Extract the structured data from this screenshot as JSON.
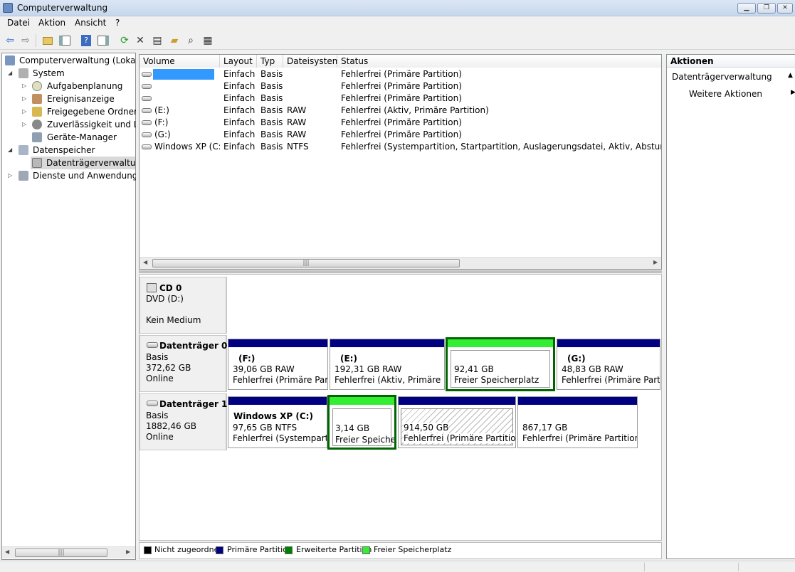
{
  "window": {
    "title": "Computerverwaltung"
  },
  "menubar": {
    "items": [
      "Datei",
      "Aktion",
      "Ansicht",
      "?"
    ]
  },
  "toolbar": {
    "icons": [
      "back-icon",
      "forward-icon",
      "up-folder-icon",
      "show-hide-tree-icon",
      "help-icon",
      "show-hide-action-pane-icon",
      "refresh-icon",
      "delete-icon",
      "properties-icon",
      "open-icon",
      "search-icon",
      "disk-settings-icon"
    ]
  },
  "tree": {
    "root": "Computerverwaltung (Lokal)",
    "system": "System",
    "aufgaben": "Aufgabenplanung",
    "ereignis": "Ereignisanzeige",
    "freigabe": "Freigegebene Ordner",
    "zuverl": "Zuverlässigkeit und Leis",
    "geraete": "Geräte-Manager",
    "datenspeicher": "Datenspeicher",
    "datentraeger": "Datenträgerverwaltung",
    "dienste": "Dienste und Anwendungen"
  },
  "volume_table": {
    "headers": {
      "volume": "Volume",
      "layout": "Layout",
      "typ": "Typ",
      "fs": "Dateisystem",
      "status": "Status"
    },
    "rows": [
      {
        "volume": "",
        "layout": "Einfach",
        "typ": "Basis",
        "fs": "",
        "status": "Fehlerfrei (Primäre Partition)"
      },
      {
        "volume": "",
        "layout": "Einfach",
        "typ": "Basis",
        "fs": "",
        "status": "Fehlerfrei (Primäre Partition)"
      },
      {
        "volume": "",
        "layout": "Einfach",
        "typ": "Basis",
        "fs": "",
        "status": "Fehlerfrei (Primäre Partition)"
      },
      {
        "volume": "(E:)",
        "layout": "Einfach",
        "typ": "Basis",
        "fs": "RAW",
        "status": "Fehlerfrei (Aktiv, Primäre Partition)"
      },
      {
        "volume": "(F:)",
        "layout": "Einfach",
        "typ": "Basis",
        "fs": "RAW",
        "status": "Fehlerfrei (Primäre Partition)"
      },
      {
        "volume": "(G:)",
        "layout": "Einfach",
        "typ": "Basis",
        "fs": "RAW",
        "status": "Fehlerfrei (Primäre Partition)"
      },
      {
        "volume": "Windows XP (C:)",
        "layout": "Einfach",
        "typ": "Basis",
        "fs": "NTFS",
        "status": "Fehlerfrei (Systempartition, Startpartition, Auslagerungsdatei, Aktiv, Absturzabbild, Pri"
      }
    ]
  },
  "disks": {
    "cd0": {
      "name": "CD 0",
      "type": "DVD (D:)",
      "status": "Kein Medium"
    },
    "disk0": {
      "name": "Datenträger 0",
      "kind": "Basis",
      "size": "372,62 GB",
      "status": "Online",
      "parts": [
        {
          "label": "(F:)",
          "size": "39,06 GB RAW",
          "status": "Fehlerfrei (Primäre Partit"
        },
        {
          "label": "(E:)",
          "size": "192,31 GB RAW",
          "status": "Fehlerfrei (Aktiv, Primäre Pa"
        },
        {
          "label": "",
          "size": "92,41 GB",
          "status": "Freier Speicherplatz"
        },
        {
          "label": "(G:)",
          "size": "48,83 GB RAW",
          "status": "Fehlerfrei (Primäre Partiti"
        }
      ]
    },
    "disk1": {
      "name": "Datenträger 1",
      "kind": "Basis",
      "size": "1882,46 GB",
      "status": "Online",
      "parts": [
        {
          "label": "Windows XP  (C:)",
          "size": "97,65 GB NTFS",
          "status": "Fehlerfrei (Systempartiti"
        },
        {
          "label": "",
          "size": "3,14 GB",
          "status": "Freier Speiche"
        },
        {
          "label": "",
          "size": "914,50 GB",
          "status": "Fehlerfrei (Primäre Partition)"
        },
        {
          "label": "",
          "size": "867,17 GB",
          "status": "Fehlerfrei (Primäre Partition)"
        }
      ]
    }
  },
  "legend": [
    {
      "label": "Nicht zugeordnet",
      "color": "#000000"
    },
    {
      "label": "Primäre Partition",
      "color": "#000080"
    },
    {
      "label": "Erweiterte Partition",
      "color": "#008000"
    },
    {
      "label": "Freier Speicherplatz",
      "color": "#33ee33"
    }
  ],
  "actions": {
    "title": "Aktionen",
    "section": "Datenträgerverwaltung",
    "more": "Weitere Aktionen"
  },
  "colors": {
    "primary": "#000080",
    "free": "#33ee33",
    "extended": "#006400",
    "selection": "#3399ff"
  }
}
